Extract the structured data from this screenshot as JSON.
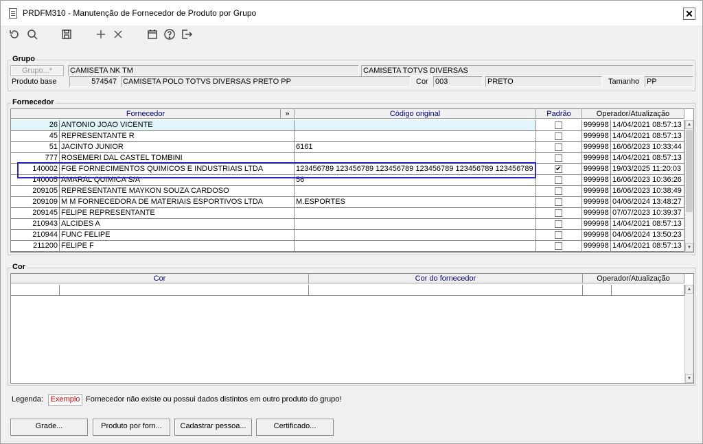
{
  "window": {
    "title": "PRDFM310 - Manutenção de Fornecedor de Produto por Grupo",
    "close_label": "✕"
  },
  "toolbar": {
    "icons": [
      "undo-icon",
      "search-icon",
      "save-icon",
      "add-icon",
      "delete-icon",
      "calendar-icon",
      "help-icon",
      "exit-icon"
    ]
  },
  "grupo": {
    "legend": "Grupo",
    "button_label": "Grupo...*",
    "group_value": "CAMISETA NK TM",
    "group_desc": "CAMISETA TOTVS DIVERSAS",
    "produto_label": "Produto base",
    "produto_code": "574547",
    "produto_desc": "CAMISETA POLO TOTVS DIVERSAS PRETO PP",
    "cor_label": "Cor",
    "cor_code": "003",
    "cor_desc": "PRETO",
    "tamanho_label": "Tamanho",
    "tamanho_value": "PP"
  },
  "fornecedor": {
    "legend": "Fornecedor",
    "headers": {
      "fornecedor": "Fornecedor",
      "expand": "»",
      "codigo": "Código original",
      "padrao": "Padrão",
      "operador": "Operador/Atualização"
    },
    "rows": [
      {
        "code": "26",
        "name": "ANTONIO JOAO VICENTE",
        "codigo": "",
        "padrao": false,
        "op": "999998",
        "date": "14/04/2021 08:57:13"
      },
      {
        "code": "45",
        "name": "REPRESENTANTE R",
        "codigo": "",
        "padrao": false,
        "op": "999998",
        "date": "14/04/2021 08:57:13"
      },
      {
        "code": "51",
        "name": "JACINTO JUNIOR",
        "codigo": "6161",
        "padrao": false,
        "op": "999998",
        "date": "16/06/2023 10:33:44"
      },
      {
        "code": "777",
        "name": "ROSEMERI DAL CASTEL TOMBINI",
        "codigo": "",
        "padrao": false,
        "op": "999998",
        "date": "14/04/2021 08:57:13"
      },
      {
        "code": "140002",
        "name": "FGE FORNECIMENTOS QUIMICOS E INDUSTRIAIS LTDA",
        "codigo": "123456789 123456789 123456789 123456789 123456789 123456789",
        "padrao": true,
        "op": "999998",
        "date": "19/03/2025 11:20:03"
      },
      {
        "code": "140005",
        "name": "AMARAL QUIMICA S/A",
        "codigo": "56",
        "padrao": false,
        "op": "999998",
        "date": "16/06/2023 10:36:26"
      },
      {
        "code": "209105",
        "name": "REPRESENTANTE MAYKON SOUZA CARDOSO",
        "codigo": "",
        "padrao": false,
        "op": "999998",
        "date": "16/06/2023 10:38:49"
      },
      {
        "code": "209109",
        "name": "M M    FORNECEDORA DE MATERIAIS ESPORTIVOS  LTDA",
        "codigo": "M.ESPORTES",
        "padrao": false,
        "op": "999998",
        "date": "04/06/2024 13:48:27"
      },
      {
        "code": "209145",
        "name": "FELIPE REPRESENTANTE",
        "codigo": "",
        "padrao": false,
        "op": "999998",
        "date": "07/07/2023 10:39:37"
      },
      {
        "code": "210943",
        "name": "ALCIDES A",
        "codigo": "",
        "padrao": false,
        "op": "999998",
        "date": "14/04/2021 08:57:13"
      },
      {
        "code": "210944",
        "name": "FUNC FELIPE",
        "codigo": "",
        "padrao": false,
        "op": "999998",
        "date": "04/06/2024 13:50:23"
      },
      {
        "code": "211200",
        "name": "FELIPE F",
        "codigo": "",
        "padrao": false,
        "op": "999998",
        "date": "14/04/2021 08:57:13"
      }
    ]
  },
  "cor": {
    "legend": "Cor",
    "headers": {
      "cor": "Cor",
      "cor_fornecedor": "Cor do fornecedor",
      "operador": "Operador/Atualização"
    }
  },
  "legenda": {
    "label": "Legenda:",
    "exemplo": "Exemplo",
    "text": "Fornecedor não existe ou possui dados distintos em outro produto do grupo!"
  },
  "buttons": {
    "grade": "Grade...",
    "produto_forn": "Produto por forn...",
    "cadastrar": "Cadastrar pessoa...",
    "certificado": "Certificado..."
  },
  "colors": {
    "selection_row": "#e0f6fb",
    "highlight_border": "#2a2ad0",
    "header_text": "#00007f",
    "exemplo_text": "#c00000"
  }
}
